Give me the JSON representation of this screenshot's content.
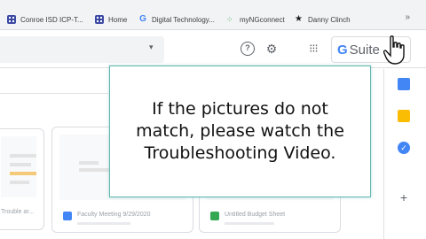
{
  "bookmarks": {
    "items": [
      {
        "label": "Conroe ISD ICP-T...",
        "icon": "grid-icon"
      },
      {
        "label": "Home",
        "icon": "grid-icon"
      },
      {
        "label": "Digital Technology...",
        "icon": "google-g-icon"
      },
      {
        "label": "myNGconnect",
        "icon": "ngconnect-icon"
      },
      {
        "label": "Danny Clinch",
        "icon": "star-icon"
      }
    ],
    "overflow": "»"
  },
  "header": {
    "dropdown_glyph": "▾",
    "help_glyph": "?",
    "gear_glyph": "⚙",
    "apps_glyph": "⁝⁝⁝",
    "gsuite_g": "G",
    "gsuite_label": "Suite"
  },
  "cards": [
    {
      "title": "Trouble ar..."
    },
    {
      "title": "Faculty Meeting 9/29/2020"
    },
    {
      "title": "Untitled Budget Sheet"
    }
  ],
  "overlay": {
    "message": "If the pictures do not\nmatch, please watch the\nTroubleshooting Video."
  },
  "colors": {
    "accent_border": "#62b7b0",
    "google_blue": "#4285f4",
    "keep_yellow": "#fbbc04",
    "sheets_green": "#34a853"
  }
}
